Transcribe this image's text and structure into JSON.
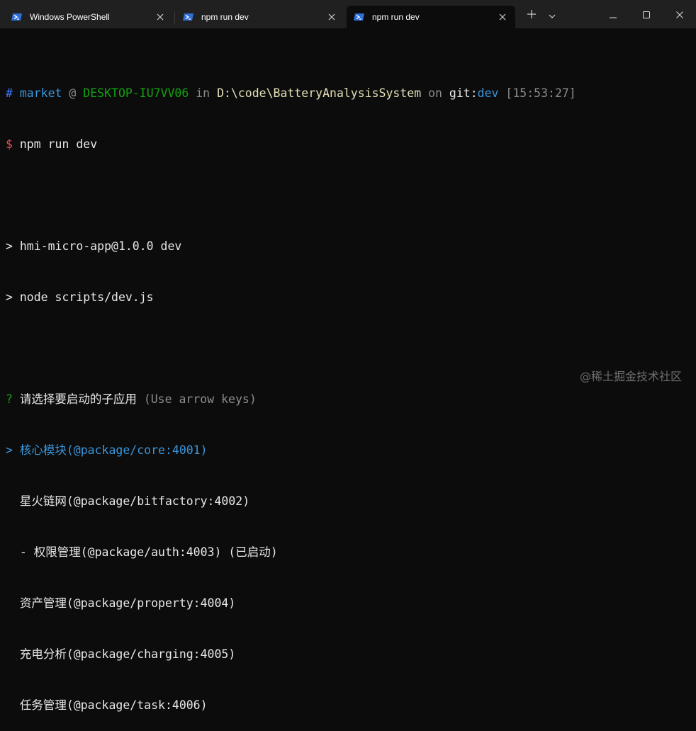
{
  "tabs": [
    {
      "label": "Windows PowerShell",
      "icon": "powershell-icon"
    },
    {
      "label": "npm run dev",
      "icon": "powershell-icon"
    },
    {
      "label": "npm run dev",
      "icon": "powershell-icon",
      "active": true
    }
  ],
  "prompt": {
    "hash": "#",
    "user": "market",
    "at": "@",
    "host": "DESKTOP-IU7VV06",
    "in": "in",
    "path": "D:\\code\\BatteryAnalysisSystem",
    "on": "on",
    "git": "git:",
    "branch_icon": "",
    "branch": "dev",
    "time": "[15:53:27]",
    "dollar": "$",
    "command": "npm run dev"
  },
  "output": {
    "line1": "> hmi-micro-app@1.0.0 dev",
    "line2": "> node scripts/dev.js"
  },
  "question": {
    "mark": "?",
    "text": "请选择要启动的子应用",
    "hint": "(Use arrow keys)"
  },
  "options": [
    {
      "pointer": ">",
      "label": "核心模块(@package/core:4001)",
      "selected": true
    },
    {
      "pointer": " ",
      "label": "星火链网(@package/bitfactory:4002)"
    },
    {
      "pointer": " ",
      "label": "- 权限管理(@package/auth:4003) (已启动)"
    },
    {
      "pointer": " ",
      "label": "资产管理(@package/property:4004)"
    },
    {
      "pointer": " ",
      "label": "充电分析(@package/charging:4005)"
    },
    {
      "pointer": " ",
      "label": "任务管理(@package/task:4006)"
    }
  ],
  "watermark": "@稀土掘金技术社区",
  "colors": {
    "background": "#0c0c0c",
    "titlebar": "#202020",
    "accent_blue": "#3b78ff",
    "accent_green": "#13a10e",
    "accent_red": "#e74856",
    "selected_option": "#3a96dd"
  }
}
